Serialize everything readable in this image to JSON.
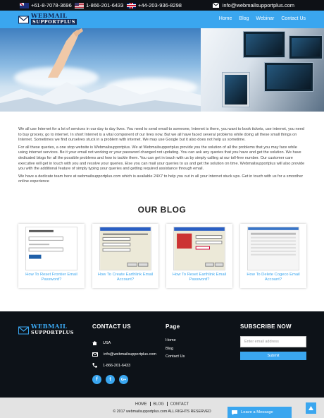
{
  "topbar": {
    "phones": [
      {
        "flag": "australia-flag",
        "number": "+61-8-7078-3696"
      },
      {
        "flag": "usa-flag",
        "number": "1-866-201-6433"
      },
      {
        "flag": "uk-flag",
        "number": "+44-203-936-8298"
      }
    ],
    "email": "info@webmailsupportplus.com"
  },
  "brand": {
    "line1": "WEBMAIL",
    "line2": "SUPPORTPLUS"
  },
  "nav": {
    "items": [
      "Home",
      "Blog",
      "Webinar",
      "Contact Us"
    ]
  },
  "intro": {
    "paragraphs": [
      "We all use Internet for a lot of services in our day to day lives. You need to send email to someone, Internet is there, you want to book tickets, use internet, you need to buy grocery, go to internet. In short Internet is a vital component of our lives now. But we all have faced several problems while doing all these small things on Internet. Sometimes we find ourselves stuck in a problem with internet. We may use Google but it also does not help us sometime.",
      "For all these queries, a one stop website is Webmailsupportplus. We at Webmailsupportplus provide you the solution of all the problems that you may face while using internet services. Be it your email not working or your password changed not updating. You can ask any queries that you have and get the solution. We have dedicated blogs for all the possible problems and how to tackle them. You can get in touch with us by simply calling at our toll-free number. Our customer care executive will get in touch with you and resolve your queries. Else you can mail your queries to us and get the solution on time. Webmailsupportplus will also provide you with the additional feature of simply typing your queries and getting required assistance through email.",
      "We have a dedicate team here at webmailsupportplus.com which is available 24X7 to help you out in all your internet stuck ups. Get in touch with us for a smoother online experience"
    ]
  },
  "blog": {
    "heading": "OUR BLOG",
    "posts": [
      {
        "title": "How To Reset Frontier Email Password?"
      },
      {
        "title": "How To Create Earthlink Email Account?"
      },
      {
        "title": "How To Reset Earthlink Email Password?"
      },
      {
        "title": "How To Delete Cogeco Email Account?"
      }
    ]
  },
  "footer": {
    "contact": {
      "heading": "CONTACT US",
      "country": "USA",
      "email": "info@webmailsupportplus.com",
      "phone": "1-866-201-6433"
    },
    "social": [
      "f",
      "t",
      "G+"
    ],
    "page": {
      "heading": "Page",
      "links": [
        "Home",
        "Blog",
        "Contact Us"
      ]
    },
    "subscribe": {
      "heading": "SUBSCRIBE NOW",
      "placeholder": "Enter email address",
      "button": "Submit"
    }
  },
  "bottom": {
    "links": [
      "HOME",
      "BLOG",
      "CONTACT"
    ],
    "copyright": "© 2017 webmailsupportplus.com ALL RIGHTS RESERVED"
  },
  "chat": {
    "label": "Leave a Message"
  },
  "colors": {
    "accent": "#3aa6ef",
    "dark": "#0d1218",
    "navy": "#122a56"
  }
}
